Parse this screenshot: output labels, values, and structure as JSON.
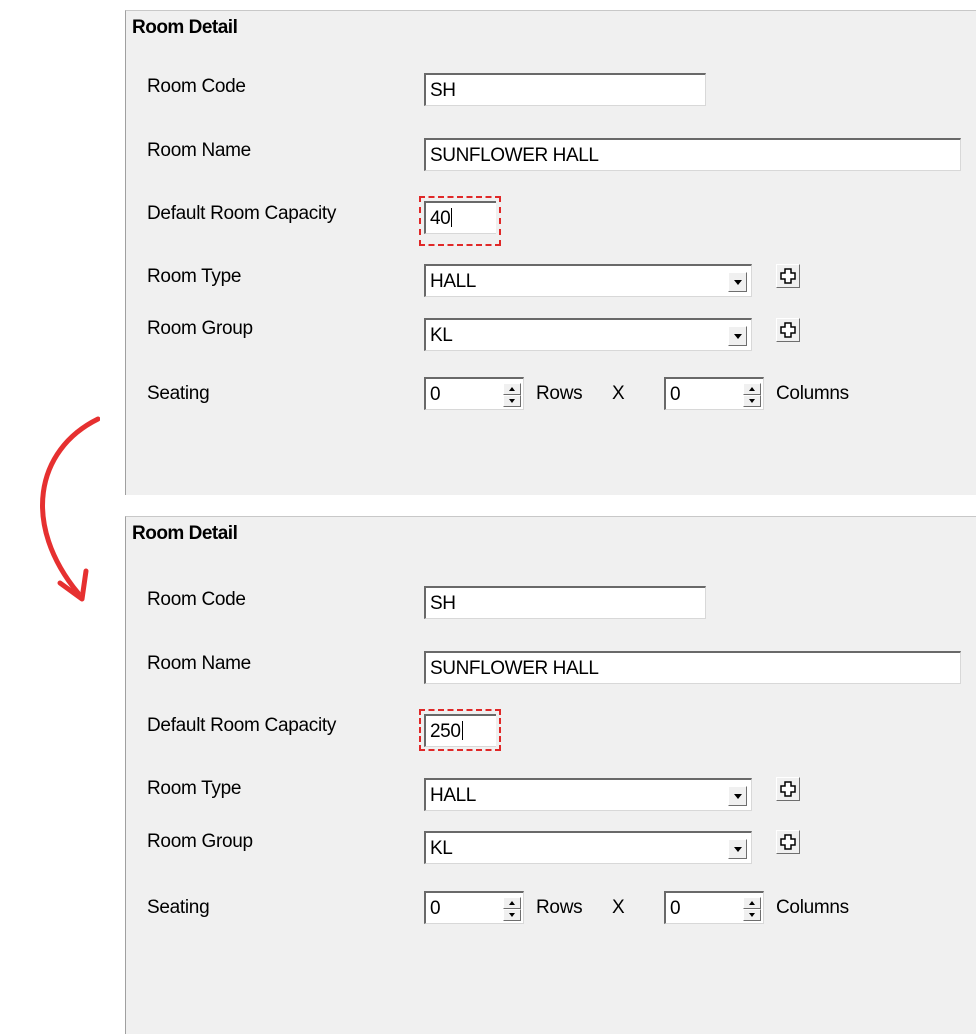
{
  "labels": {
    "panel_title": "Room Detail",
    "room_code": "Room Code",
    "room_name": "Room Name",
    "capacity": "Default Room Capacity",
    "room_type": "Room Type",
    "room_group": "Room Group",
    "seating": "Seating",
    "rows": "Rows",
    "x": "X",
    "columns": "Columns"
  },
  "before": {
    "room_code": "SH",
    "room_name": "SUNFLOWER HALL",
    "capacity": "40",
    "room_type": "HALL",
    "room_group": "KL",
    "rows": "0",
    "columns": "0"
  },
  "after": {
    "room_code": "SH",
    "room_name": "SUNFLOWER HALL",
    "capacity": "250",
    "room_type": "HALL",
    "room_group": "KL",
    "rows": "0",
    "columns": "0"
  },
  "colors": {
    "highlight": "#e02828",
    "arrow": "#e63030",
    "panel_bg": "#f0f0f0"
  },
  "icons": {
    "transition": "curved-arrow-down-icon",
    "add": "plus-icon",
    "dropdown": "chevron-down-icon"
  }
}
